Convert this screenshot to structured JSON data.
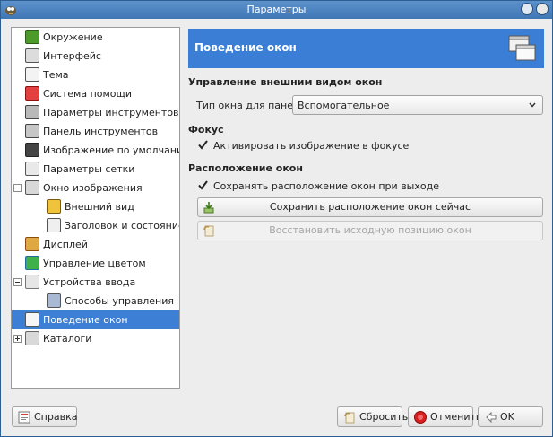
{
  "window": {
    "title": "Параметры"
  },
  "tree": {
    "items": [
      {
        "label": "Окружение",
        "icon": "environment-icon",
        "level": 0
      },
      {
        "label": "Интерфейс",
        "icon": "interface-icon",
        "level": 0
      },
      {
        "label": "Тема",
        "icon": "theme-icon",
        "level": 0
      },
      {
        "label": "Система помощи",
        "icon": "help-system-icon",
        "level": 0
      },
      {
        "label": "Параметры инструментов",
        "icon": "tool-options-icon",
        "level": 0
      },
      {
        "label": "Панель инструментов",
        "icon": "toolbox-icon",
        "level": 0
      },
      {
        "label": "Изображение по умолчанию",
        "icon": "default-image-icon",
        "level": 0
      },
      {
        "label": "Параметры сетки",
        "icon": "grid-icon",
        "level": 0
      },
      {
        "label": "Окно изображения",
        "icon": "image-window-icon",
        "level": 0,
        "expander": "expanded"
      },
      {
        "label": "Внешний вид",
        "icon": "appearance-icon",
        "level": 1
      },
      {
        "label": "Заголовок и состояние",
        "icon": "title-status-icon",
        "level": 1
      },
      {
        "label": "Дисплей",
        "icon": "display-icon",
        "level": 0
      },
      {
        "label": "Управление цветом",
        "icon": "color-management-icon",
        "level": 0
      },
      {
        "label": "Устройства ввода",
        "icon": "input-devices-icon",
        "level": 0,
        "expander": "expanded"
      },
      {
        "label": "Способы управления",
        "icon": "input-controllers-icon",
        "level": 1
      },
      {
        "label": "Поведение окон",
        "icon": "window-management-icon",
        "level": 0,
        "selected": true
      },
      {
        "label": "Каталоги",
        "icon": "folders-icon",
        "level": 0,
        "expander": "collapsed"
      }
    ]
  },
  "panel": {
    "title": "Поведение окон",
    "section_appearance": "Управление внешним видом окон",
    "hint_label": "Тип окна для панелей:",
    "hint_value": "Вспомогательное",
    "section_focus": "Фокус",
    "focus_check": "Активировать изображение в фокусе",
    "section_positions": "Расположение окон",
    "save_on_exit_check": "Сохранять расположение окон при выходе",
    "save_now_button": "Сохранить расположение окон сейчас",
    "reset_button": "Восстановить исходную позицию окон"
  },
  "buttons": {
    "help": "Справка",
    "reset": "Сбросить",
    "cancel": "Отменить",
    "ok": "OK"
  },
  "colors": {
    "accent": "#3a7fd5",
    "titlebar": "#4a80bf"
  }
}
